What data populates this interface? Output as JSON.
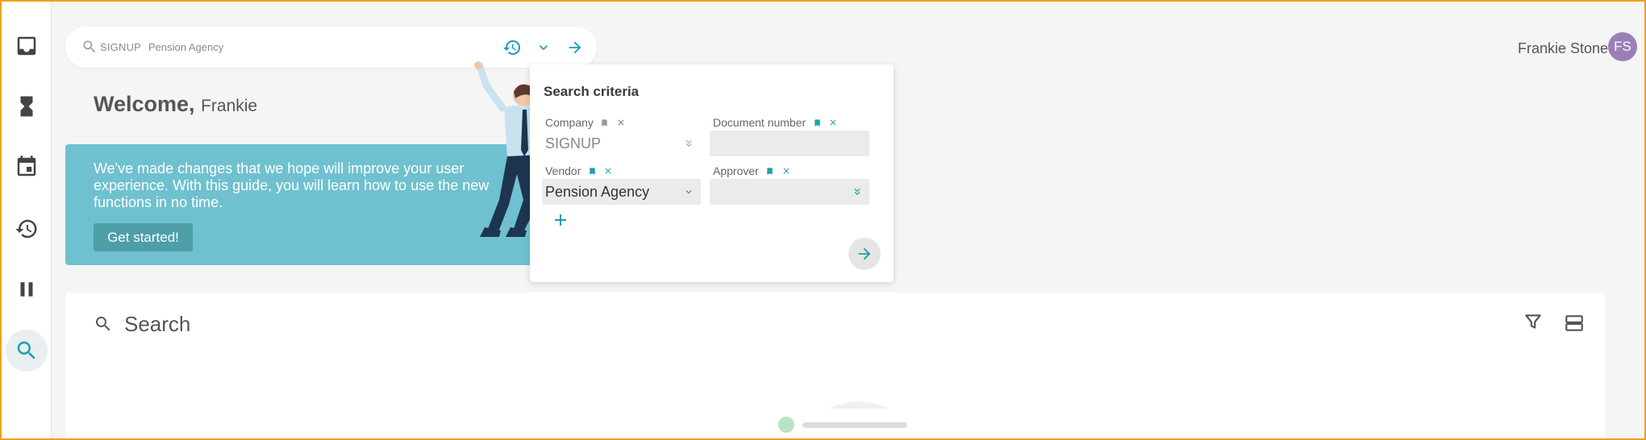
{
  "colors": {
    "accent": "#1a9fb0",
    "banner": "#6fc1cf",
    "banner_button": "#4e9ea8",
    "avatar": "#9b7fb6",
    "frame": "#f0a020"
  },
  "sidebar": {
    "items": [
      {
        "name": "inbox",
        "icon": "inbox-icon"
      },
      {
        "name": "pending",
        "icon": "hourglass-icon"
      },
      {
        "name": "calendar",
        "icon": "calendar-icon"
      },
      {
        "name": "history",
        "icon": "history-icon"
      },
      {
        "name": "paused",
        "icon": "pause-icon"
      },
      {
        "name": "search",
        "icon": "search-icon",
        "active": true
      }
    ]
  },
  "searchbar": {
    "company_chip": "SIGNUP",
    "vendor_chip": "Pension Agency",
    "actions": [
      "history-icon",
      "chevron-down-icon",
      "arrow-right-icon"
    ]
  },
  "user": {
    "name": "Frankie Stone",
    "initials": "FS"
  },
  "welcome": {
    "greeting": "Welcome,",
    "name": "Frankie"
  },
  "banner": {
    "text": "We've made changes that we hope will improve your user experience. With this guide, you will learn how to use the new functions in no time.",
    "button_label": "Get started!"
  },
  "criteria": {
    "title": "Search criteria",
    "fields": {
      "company": {
        "label": "Company",
        "value": "SIGNUP"
      },
      "document_number": {
        "label": "Document number",
        "value": ""
      },
      "vendor": {
        "label": "Vendor",
        "value": "Pension Agency"
      },
      "approver": {
        "label": "Approver",
        "value": ""
      }
    }
  },
  "panel": {
    "title": "Search"
  }
}
